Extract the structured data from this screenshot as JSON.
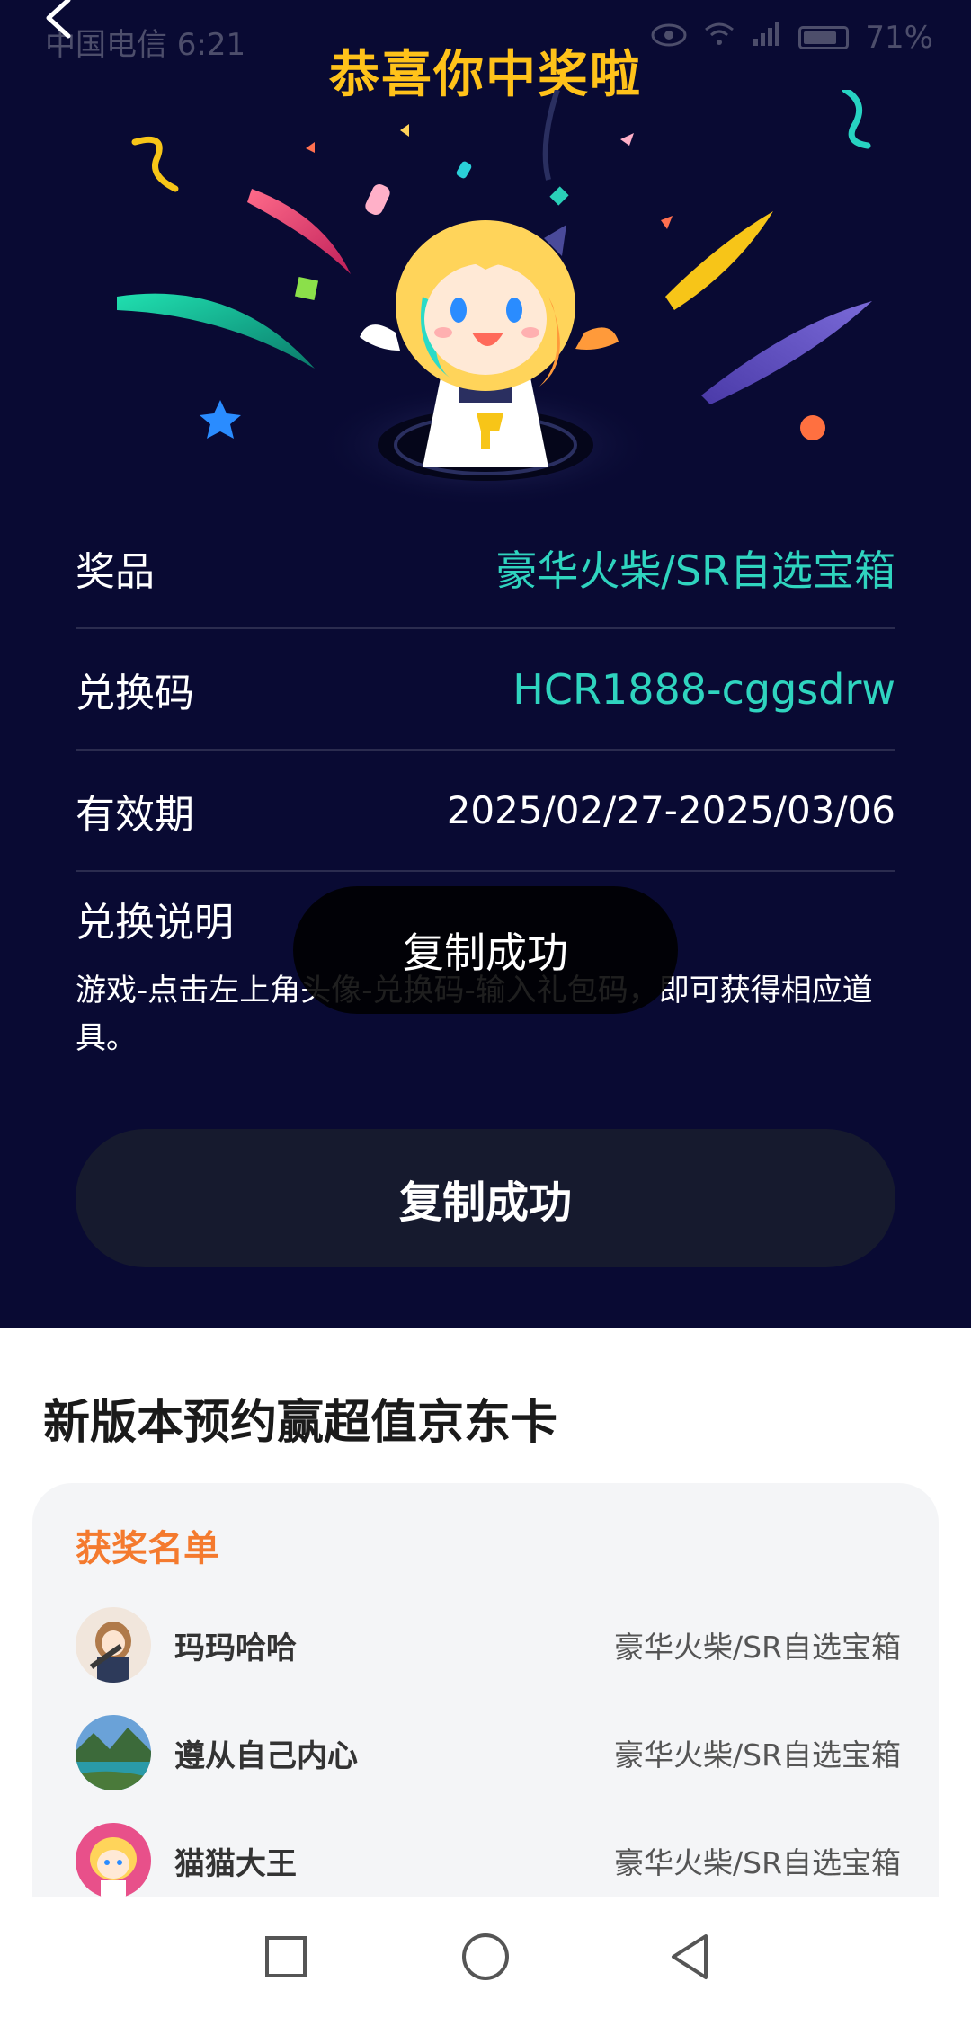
{
  "status_bar": {
    "carrier_time": "中国电信 6:21",
    "battery": "71%"
  },
  "header": {
    "title": "恭喜你中奖啦"
  },
  "prize_details": [
    {
      "label": "奖品",
      "value": "豪华火柴/SR自选宝箱"
    },
    {
      "label": "兑换码",
      "value": "HCR1888-cggsdrw"
    },
    {
      "label": "有效期",
      "value": "2025/02/27-2025/03/06"
    }
  ],
  "instructions": {
    "title": "兑换说明",
    "text": "游戏-点击左上角头像-兑换码-输入礼包码，即可获得相应道具。"
  },
  "toast": "复制成功",
  "copy_button_label": "复制成功",
  "promo": {
    "title": "新版本预约赢超值京东卡",
    "winners_title": "获奖名单",
    "winners": [
      {
        "name": "玛玛哈哈",
        "prize": "豪华火柴/SR自选宝箱"
      },
      {
        "name": "遵从自己内心",
        "prize": "豪华火柴/SR自选宝箱"
      },
      {
        "name": "猫猫大王",
        "prize": "豪华火柴/SR自选宝箱"
      }
    ]
  },
  "icons": [
    "back-chevron-icon",
    "eye-icon",
    "wifi-icon",
    "signal-icon",
    "battery-icon",
    "nav-square-icon",
    "nav-circle-icon",
    "nav-triangle-icon"
  ],
  "colors": {
    "panel_bg": "#090a33",
    "title_yellow": "#ffc21a",
    "value_teal": "#2fd4bf",
    "winners_title_orange": "#f47a2e"
  }
}
